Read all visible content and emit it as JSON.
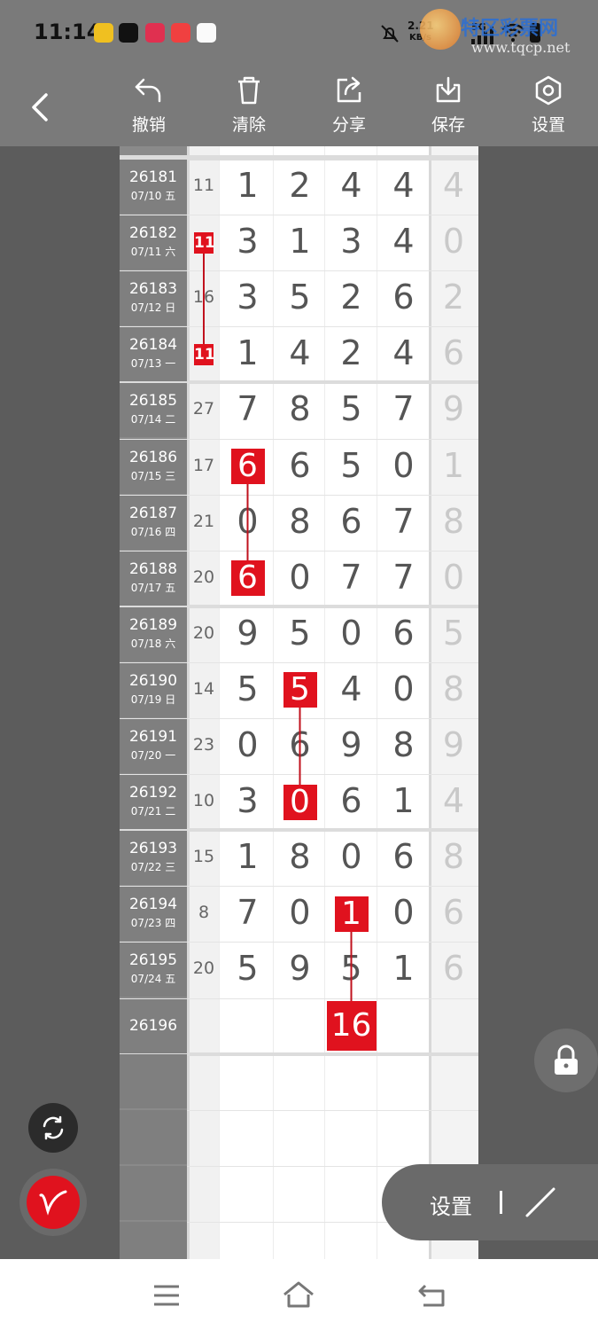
{
  "status_bar": {
    "time": "11:14",
    "network_speed": "2.21",
    "network_unit": "KB/s",
    "signal_label": "5G",
    "watermark_name": "特区彩票网",
    "watermark_url": "www.tqcp.net"
  },
  "toolbar": {
    "undo_label": "撤销",
    "clear_label": "清除",
    "share_label": "分享",
    "save_label": "保存",
    "settings_label": "设置"
  },
  "rows": [
    {
      "period": "26181",
      "date": "07/10 五",
      "sum": "11",
      "digits": [
        "1",
        "2",
        "4",
        "4"
      ],
      "extra": "4"
    },
    {
      "period": "26182",
      "date": "07/11 六",
      "sum": "11",
      "digits": [
        "3",
        "1",
        "3",
        "4"
      ],
      "extra": "0"
    },
    {
      "period": "26183",
      "date": "07/12 日",
      "sum": "16",
      "digits": [
        "3",
        "5",
        "2",
        "6"
      ],
      "extra": "2"
    },
    {
      "period": "26184",
      "date": "07/13 一",
      "sum": "11",
      "digits": [
        "1",
        "4",
        "2",
        "4"
      ],
      "extra": "6"
    },
    {
      "period": "26185",
      "date": "07/14 二",
      "sum": "27",
      "digits": [
        "7",
        "8",
        "5",
        "7"
      ],
      "extra": "9"
    },
    {
      "period": "26186",
      "date": "07/15 三",
      "sum": "17",
      "digits": [
        "6",
        "6",
        "5",
        "0"
      ],
      "extra": "1"
    },
    {
      "period": "26187",
      "date": "07/16 四",
      "sum": "21",
      "digits": [
        "0",
        "8",
        "6",
        "7"
      ],
      "extra": "8"
    },
    {
      "period": "26188",
      "date": "07/17 五",
      "sum": "20",
      "digits": [
        "6",
        "0",
        "7",
        "7"
      ],
      "extra": "0"
    },
    {
      "period": "26189",
      "date": "07/18 六",
      "sum": "20",
      "digits": [
        "9",
        "5",
        "0",
        "6"
      ],
      "extra": "5"
    },
    {
      "period": "26190",
      "date": "07/19 日",
      "sum": "14",
      "digits": [
        "5",
        "5",
        "4",
        "0"
      ],
      "extra": "8"
    },
    {
      "period": "26191",
      "date": "07/20 一",
      "sum": "23",
      "digits": [
        "0",
        "6",
        "9",
        "8"
      ],
      "extra": "9"
    },
    {
      "period": "26192",
      "date": "07/21 二",
      "sum": "10",
      "digits": [
        "3",
        "0",
        "6",
        "1"
      ],
      "extra": "4"
    },
    {
      "period": "26193",
      "date": "07/22 三",
      "sum": "15",
      "digits": [
        "1",
        "8",
        "0",
        "6"
      ],
      "extra": "8"
    },
    {
      "period": "26194",
      "date": "07/23 四",
      "sum": "8",
      "digits": [
        "7",
        "0",
        "1",
        "0"
      ],
      "extra": "6"
    },
    {
      "period": "26195",
      "date": "07/24 五",
      "sum": "20",
      "digits": [
        "5",
        "9",
        "5",
        "1"
      ],
      "extra": "6"
    },
    {
      "period": "26196",
      "date": "",
      "sum": "",
      "digits": [
        "",
        "",
        "",
        ""
      ],
      "extra": ""
    }
  ],
  "highlights": [
    {
      "row": 1,
      "col": "sum",
      "text": "11"
    },
    {
      "row": 3,
      "col": "sum",
      "text": "11"
    },
    {
      "row": 5,
      "col": 0,
      "text": "6"
    },
    {
      "row": 7,
      "col": 0,
      "text": "6"
    },
    {
      "row": 9,
      "col": 1,
      "text": "5"
    },
    {
      "row": 11,
      "col": 1,
      "text": "0"
    },
    {
      "row": 13,
      "col": 2,
      "text": "1"
    },
    {
      "row": 15,
      "col": 2,
      "text": "16"
    }
  ],
  "links": [
    {
      "from": 1,
      "to": 3,
      "col": "sum"
    },
    {
      "from": 5,
      "to": 7,
      "col": 0
    },
    {
      "from": 9,
      "to": 11,
      "col": 1
    },
    {
      "from": 13,
      "to": 15,
      "col": 2
    }
  ],
  "colors": {
    "highlight": "#e0121e",
    "line": "#c0121e",
    "period_bg": "#7f7f7f",
    "toolbar_bg": "#7a7a7a"
  },
  "floating": {
    "settings_label": "设置"
  }
}
